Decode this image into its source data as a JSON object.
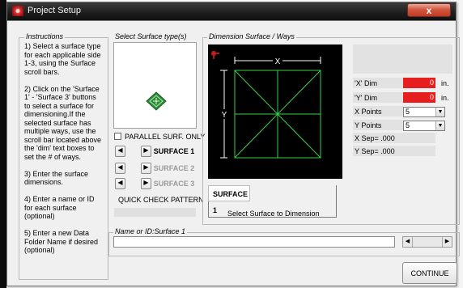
{
  "window": {
    "title": "Project Setup",
    "close_glyph": "x"
  },
  "instructions": {
    "label": "Instructions",
    "lines": [
      "1) Select a surface type",
      "for each applicable side",
      "1-3, using the Surface",
      "scroll bars.",
      "",
      "2) Click on the 'Surface",
      "1' - 'Surface 3' buttons",
      "to select a surface for",
      "dimensioning.If the",
      "selected surface has",
      "multiple ways, use the",
      "scroll bar located above",
      "the 'dim' text boxes to",
      "set the # of ways.",
      "",
      "3) Enter the surface",
      "dimensions.",
      "",
      "4) Enter a name or ID",
      "for each surface",
      "(optional)",
      "",
      "5) Enter a new Data",
      "Folder Name if desired",
      "(optional)"
    ]
  },
  "surface_type": {
    "label": "Select Surface type(s)",
    "parallel_checkbox": {
      "label": "PARALLEL SURF. ONLY",
      "checked": false
    },
    "surfaces": [
      {
        "label": "SURFACE 1",
        "active": true
      },
      {
        "label": "SURFACE 2",
        "active": false
      },
      {
        "label": "SURFACE 3",
        "active": false
      }
    ],
    "quick_check": "QUICK CHECK PATTERN"
  },
  "dimension": {
    "label": "Dimension Surface / Ways",
    "axis_x": "X",
    "axis_y": "Y",
    "current_surface": "SURFACE 1",
    "hint": "Select Surface to Dimension",
    "x_dim_label": "'X' Dim",
    "x_dim_value": "0",
    "x_dim_unit": "in.",
    "y_dim_label": "'Y' Dim",
    "y_dim_value": "0",
    "y_dim_unit": "in.",
    "x_points_label": "X Points",
    "x_points_value": "5",
    "y_points_label": "Y Points",
    "y_points_value": "5",
    "x_sep": "X Sep= .000",
    "y_sep": "Y Sep= .000"
  },
  "name_id": {
    "label": "Name or ID:Surface  1",
    "value": ""
  },
  "continue_label": "CONTINUE",
  "colors": {
    "grid_line": "#37d24a",
    "marker": "#e02020",
    "diamond": "#2f8a3a",
    "field_red": "#e61e1e"
  }
}
